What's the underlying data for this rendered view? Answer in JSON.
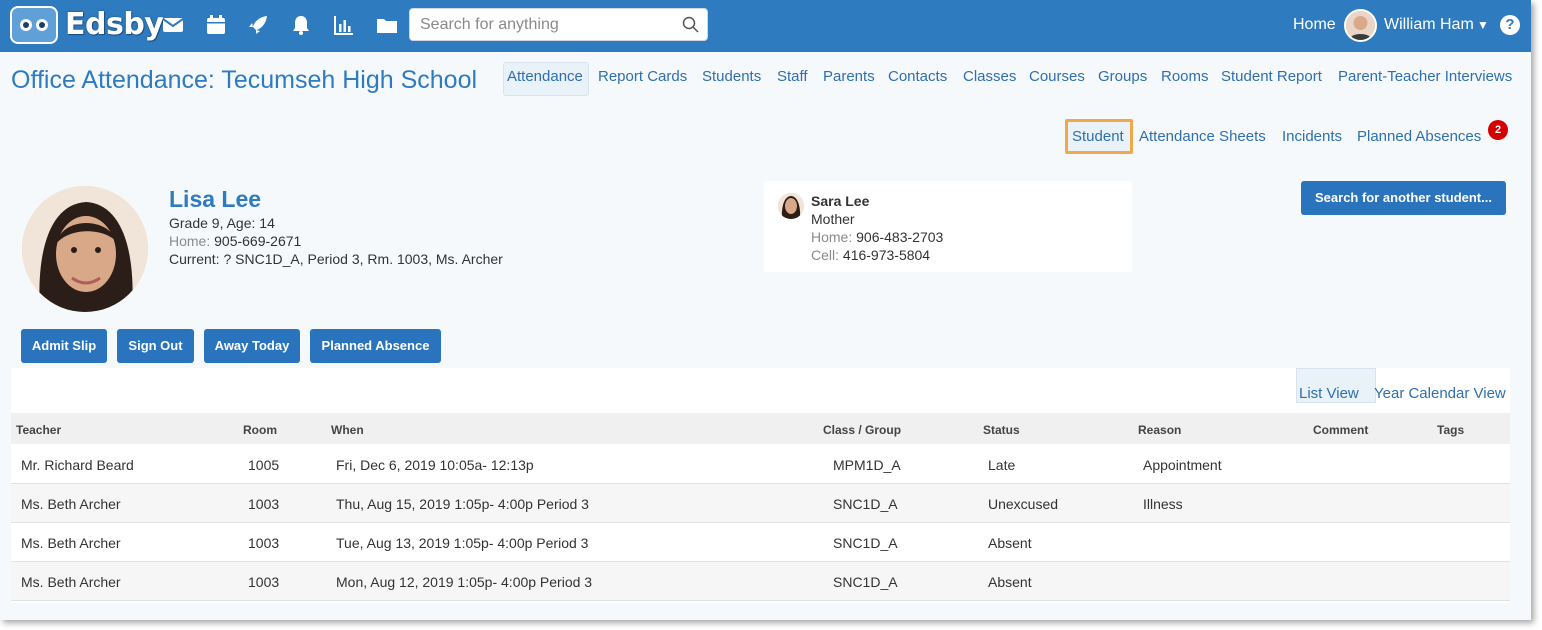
{
  "app": {
    "name": "Edsby"
  },
  "topbar": {
    "search_placeholder": "Search for anything",
    "home_label": "Home",
    "user_name": "William Ham",
    "help_label": "?",
    "icons": [
      "mail-icon",
      "calendar-icon",
      "rocket-icon",
      "bell-icon",
      "chart-icon",
      "folder-icon"
    ]
  },
  "page": {
    "title": "Office Attendance: Tecumseh High School"
  },
  "main_nav": [
    "Attendance",
    "Report Cards",
    "Students",
    "Staff",
    "Parents",
    "Contacts",
    "Classes",
    "Courses",
    "Groups",
    "Rooms",
    "Student Report",
    "Parent-Teacher Interviews"
  ],
  "main_nav_active": "Attendance",
  "sub_nav": [
    "Student",
    "Attendance Sheets",
    "Incidents",
    "Planned Absences"
  ],
  "sub_nav_active": "Student",
  "planned_absences_badge": "2",
  "student": {
    "name": "Lisa Lee",
    "grade_age": "Grade 9, Age: 14",
    "home_label": "Home:",
    "home_phone": "905-669-2671",
    "current": "Current: ?  SNC1D_A, Period 3, Rm. 1003, Ms. Archer"
  },
  "contact": {
    "name": "Sara Lee",
    "relation": "Mother",
    "home_label": "Home:",
    "home_phone": "906-483-2703",
    "cell_label": "Cell:",
    "cell_phone": "416-973-5804"
  },
  "search_student_button": "Search for another student...",
  "actions": [
    "Admit Slip",
    "Sign Out",
    "Away Today",
    "Planned Absence"
  ],
  "views": {
    "list": "List View",
    "year": "Year Calendar View",
    "active": "List View"
  },
  "table": {
    "headers": [
      "Teacher",
      "Room",
      "When",
      "Class / Group",
      "Status",
      "Reason",
      "Comment",
      "Tags"
    ],
    "rows": [
      [
        "Mr. Richard Beard",
        "1005",
        "Fri, Dec 6, 2019 10:05a- 12:13p",
        "MPM1D_A",
        "Late",
        "Appointment",
        "",
        ""
      ],
      [
        "Ms. Beth Archer",
        "1003",
        "Thu, Aug 15, 2019 1:05p- 4:00p  Period 3",
        "SNC1D_A",
        "Unexcused",
        "Illness",
        "",
        ""
      ],
      [
        "Ms. Beth Archer",
        "1003",
        "Tue, Aug 13, 2019 1:05p- 4:00p  Period 3",
        "SNC1D_A",
        "Absent",
        "",
        "",
        ""
      ],
      [
        "Ms. Beth Archer",
        "1003",
        "Mon, Aug 12, 2019 1:05p- 4:00p  Period 3",
        "SNC1D_A",
        "Absent",
        "",
        "",
        ""
      ]
    ]
  },
  "colors": {
    "brand_blue": "#2f7bbf",
    "button_blue": "#2a73bd",
    "highlight": "#f0a84a",
    "badge_red": "#d40000"
  }
}
